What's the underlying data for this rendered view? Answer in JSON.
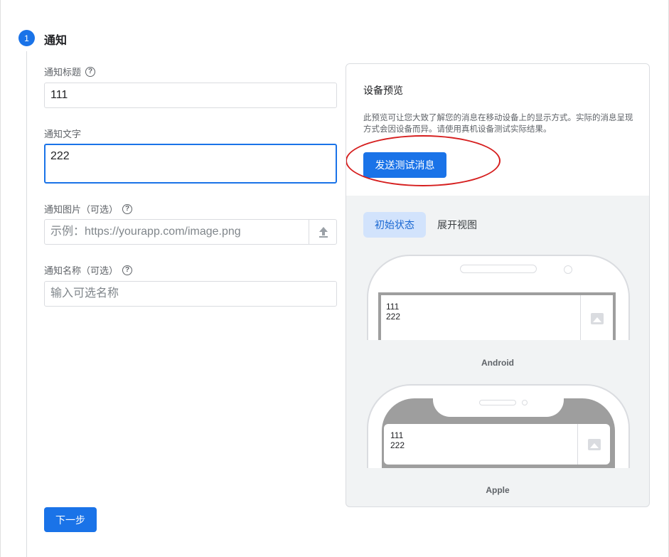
{
  "step": {
    "number": "1",
    "title": "通知"
  },
  "form": {
    "title_label": "通知标题",
    "title_value": "111",
    "text_label": "通知文字",
    "text_value": "222",
    "image_label": "通知图片（可选）",
    "image_placeholder": "示例：https://yourapp.com/image.png",
    "name_label": "通知名称（可选）",
    "name_placeholder": "输入可选名称",
    "help_glyph": "?"
  },
  "next_button": "下一步",
  "preview": {
    "title": "设备预览",
    "description": "此预览可让您大致了解您的消息在移动设备上的显示方式。实际的消息呈现方式会因设备而异。请使用真机设备测试实际结果。",
    "send_test_button": "发送测试消息",
    "tabs": [
      "初始状态",
      "展开视图"
    ],
    "android": {
      "label": "Android",
      "notif_title": "111",
      "notif_text": "222"
    },
    "apple": {
      "label": "Apple",
      "notif_title": "111",
      "notif_text": "222"
    }
  },
  "colors": {
    "accent": "#1a73e8",
    "annotation": "#d61f1f",
    "active_tab_bg": "#d2e3fc"
  }
}
